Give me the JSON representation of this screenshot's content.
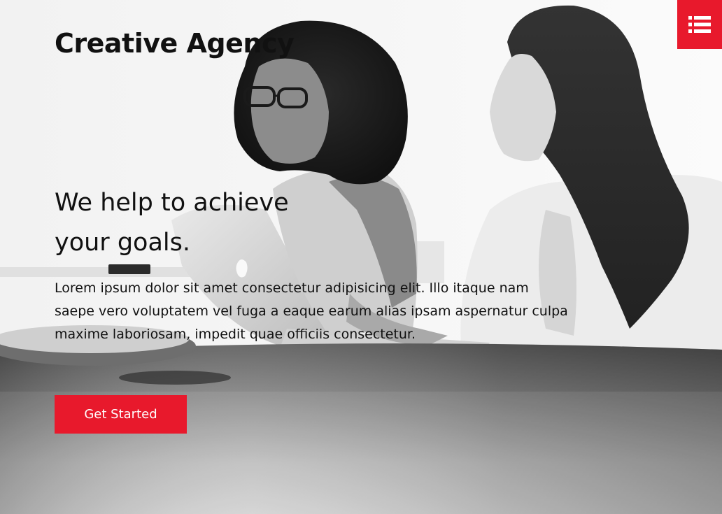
{
  "header": {
    "brand": "Creative Agency",
    "menu_icon": "list-menu-icon",
    "accent_color": "#e8192c"
  },
  "hero": {
    "background": "black-and-white-meeting-photo",
    "headline_line1": "We help to achieve",
    "headline_line2": "your goals.",
    "description": "Lorem ipsum dolor sit amet consectetur adipisicing elit. Illo itaque nam saepe vero voluptatem vel fuga a eaque earum alias ipsam aspernatur culpa maxime laboriosam, impedit quae officiis consectetur.",
    "cta_label": "Get Started"
  }
}
